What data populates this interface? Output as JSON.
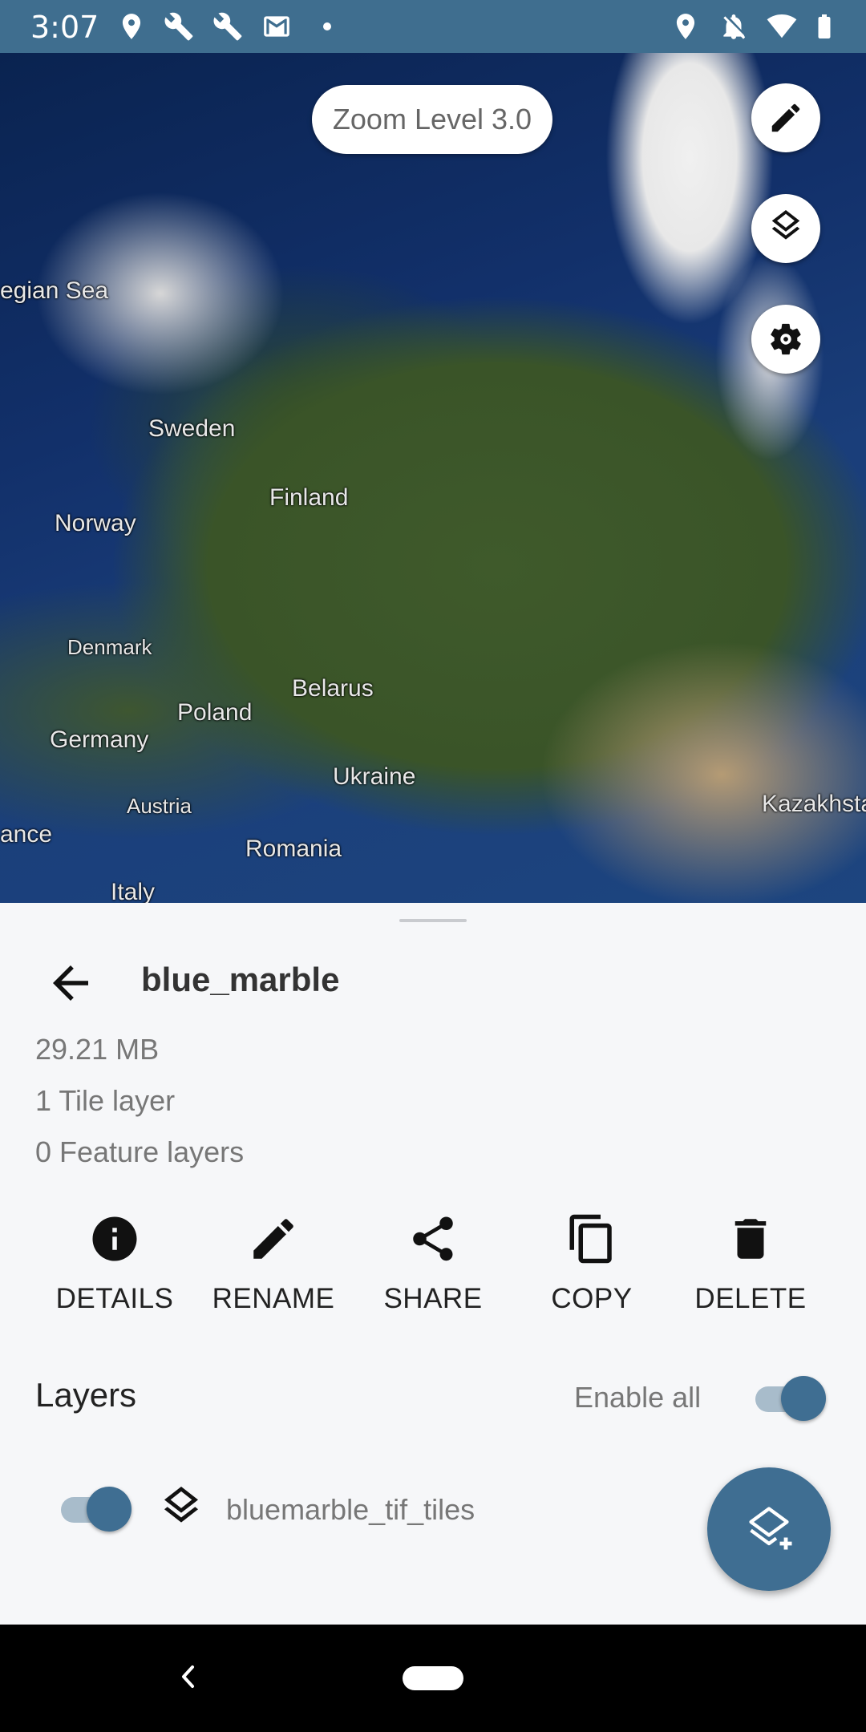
{
  "status_bar": {
    "time": "3:07",
    "icons": [
      "location-icon",
      "wrench-icon",
      "wrench-icon",
      "gmail-icon",
      "dot-icon",
      "location-icon",
      "notifications-off-icon",
      "wifi-icon",
      "battery-icon"
    ]
  },
  "map": {
    "zoom_label": "Zoom Level 3.0",
    "labels": {
      "norwegian_sea": "egian Sea",
      "sweden": "Sweden",
      "finland": "Finland",
      "norway": "Norway",
      "denmark": "Denmark",
      "belarus": "Belarus",
      "poland": "Poland",
      "germany": "Germany",
      "ukraine": "Ukraine",
      "austria": "Austria",
      "kazakhstan": "Kazakhsta",
      "france": "ance",
      "romania": "Romania",
      "italy": "Italy"
    },
    "buttons": [
      "edit-icon",
      "layers-icon",
      "settings-icon"
    ]
  },
  "sheet": {
    "title": "blue_marble",
    "size": "29.21 MB",
    "tile_layers": "1 Tile layer",
    "feature_layers": "0 Feature layers",
    "actions": {
      "details": "DETAILS",
      "rename": "RENAME",
      "share": "SHARE",
      "copy": "COPY",
      "delete": "DELETE"
    },
    "layers_title": "Layers",
    "enable_all": "Enable all",
    "enable_all_on": true,
    "layers": [
      {
        "name": "bluemarble_tif_tiles",
        "enabled": true
      }
    ]
  },
  "colors": {
    "status_bar": "#3f6e8f",
    "accent": "#3f6e92",
    "sheet_bg": "#f6f7f9"
  }
}
